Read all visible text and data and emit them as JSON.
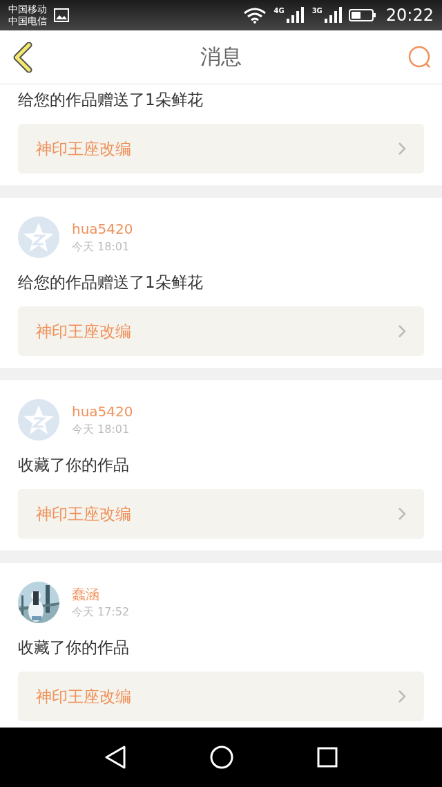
{
  "status_bar": {
    "carriers": [
      "中国移动",
      "中国电信"
    ],
    "networks": [
      "4G",
      "3G"
    ],
    "time": "20:22"
  },
  "header": {
    "title": "消息"
  },
  "messages": [
    {
      "text": "给您的作品赠送了1朵鲜花",
      "link": "神印王座改编"
    },
    {
      "user": "hua5420",
      "time": "今天 18:01",
      "avatar": {
        "kind": "default"
      },
      "text": "给您的作品赠送了1朵鲜花",
      "link": "神印王座改编"
    },
    {
      "user": "hua5420",
      "time": "今天 18:01",
      "avatar": {
        "kind": "default"
      },
      "text": "收藏了你的作品",
      "link": "神印王座改编"
    },
    {
      "user": "蠢涵",
      "time": "今天 17:52",
      "text": "收藏了你的作品",
      "link": "神印王座改编"
    }
  ]
}
